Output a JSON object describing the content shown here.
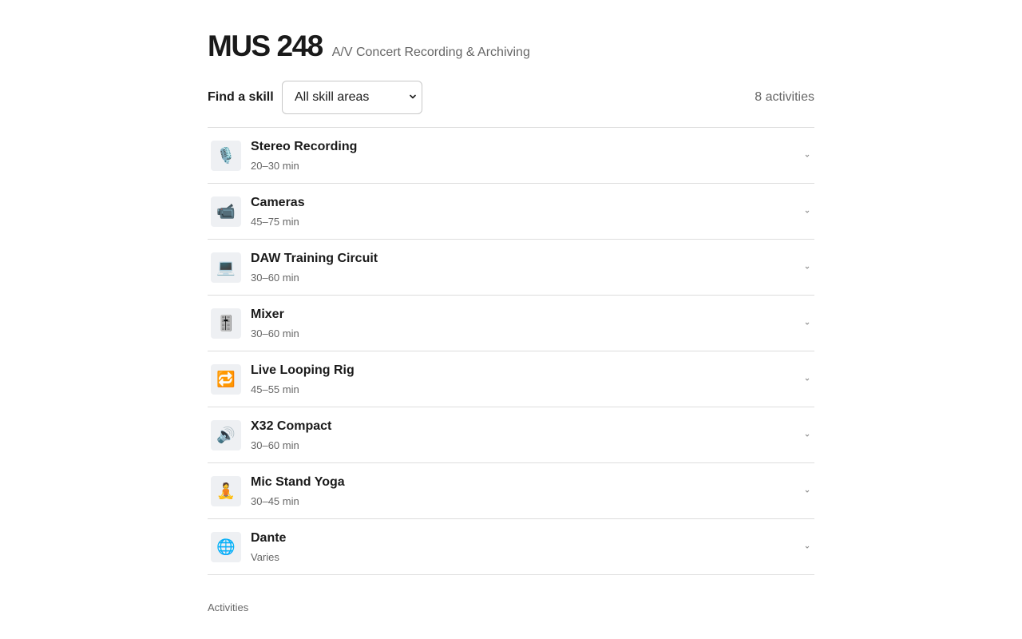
{
  "header": {
    "course_code": "MUS 248",
    "course_title": "A/V Concert Recording & Archiving"
  },
  "toolbar": {
    "find_label": "Find a skill",
    "select_value": "All skill areas",
    "activity_count": "8 activities"
  },
  "activities": [
    {
      "name": "Stereo Recording",
      "duration": "20–30 min",
      "icon": "microphone-icon",
      "glyph": "🎙️"
    },
    {
      "name": "Cameras",
      "duration": "45–75 min",
      "icon": "video-camera-icon",
      "glyph": "📹"
    },
    {
      "name": "DAW Training Circuit",
      "duration": "30–60 min",
      "icon": "laptop-icon",
      "glyph": "💻"
    },
    {
      "name": "Mixer",
      "duration": "30–60 min",
      "icon": "level-slider-icon",
      "glyph": "🎚️"
    },
    {
      "name": "Live Looping Rig",
      "duration": "45–55 min",
      "icon": "repeat-icon",
      "glyph": "🔁"
    },
    {
      "name": "X32 Compact",
      "duration": "30–60 min",
      "icon": "speaker-icon",
      "glyph": "🔊"
    },
    {
      "name": "Mic Stand Yoga",
      "duration": "30–45 min",
      "icon": "meditation-icon",
      "glyph": "🧘"
    },
    {
      "name": "Dante",
      "duration": "Varies",
      "icon": "globe-icon",
      "glyph": "🌐"
    }
  ],
  "footer": {
    "label": "Activities"
  }
}
